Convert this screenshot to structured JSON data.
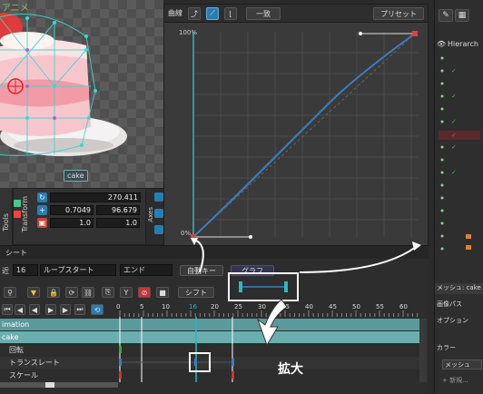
{
  "viewport": {
    "title": "アニメ",
    "mesh_label": "cake"
  },
  "tools": {
    "tools_label": "Tools",
    "transform_label": "Transform",
    "axes_label": "Axes",
    "rot_value": "270.411",
    "pos_x": "0.7049",
    "pos_y": "96.679",
    "scale_x": "1.0",
    "scale_y": "1.0"
  },
  "curve": {
    "tab_label": "曲線",
    "dropdown_label": "一致",
    "preset_label": "プリセット",
    "label_top": "100%",
    "label_bottom": "0%"
  },
  "timeline": {
    "tab_label": "シート",
    "loop_field": "16",
    "loop_start": "ループスタート",
    "loop_end": "エンド",
    "auto_label": "自動キー",
    "graph_label": "グラフ",
    "shift_label": "シフト",
    "left_small": "近",
    "ruler_ticks": [
      "0",
      "5",
      "10",
      "16",
      "20",
      "25",
      "30",
      "35",
      "40",
      "45",
      "50",
      "55",
      "60"
    ],
    "current_frame": "16",
    "tracks": [
      {
        "name": "imation"
      },
      {
        "name": "cake"
      },
      {
        "name": "回転"
      },
      {
        "name": "トランスレート"
      },
      {
        "name": "スケール"
      }
    ],
    "annotation": "拡大"
  },
  "right_panel": {
    "hierarchy_label": "Hierarch",
    "mesh_title": "メッシュ: cake",
    "image_path": "画像パス",
    "options": "オプション",
    "color_label": "カラー",
    "mesh_field": "メッシュ",
    "edit_label": "+ 新規..."
  },
  "colors": {
    "accent": "#2a9fd6",
    "track_cyan": "#5aa6a8",
    "curve_blue": "#3a7fc0",
    "key_red": "#d03030",
    "key_green": "#30b030"
  }
}
